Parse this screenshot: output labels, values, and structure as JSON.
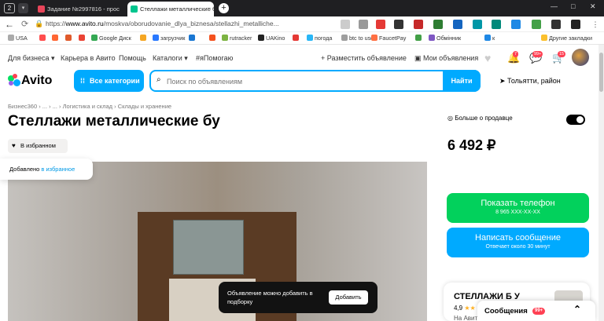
{
  "browser": {
    "tab_count": "2",
    "tabs": [
      {
        "title": "Задание №2997816 - прос",
        "favicon_color": "#e8455a"
      },
      {
        "title": "Стеллажи металлические б",
        "favicon_color": "#00c58e"
      }
    ],
    "url_host": "www.avito.ru",
    "url_prefix": "https://",
    "url_path": "/moskva/oborudovanie_dlya_biznesa/stellazhi_metalliche...",
    "tab_close": "×",
    "new_tab": "+",
    "window_buttons": [
      "—",
      "□",
      "✕"
    ]
  },
  "bookmarks": [
    {
      "label": "USA",
      "color": "#aaaaaa"
    },
    {
      "label": "",
      "color": "#ff4d4d"
    },
    {
      "label": "",
      "color": "#ff6633"
    },
    {
      "label": "",
      "color": "#e05a2b"
    },
    {
      "label": "",
      "color": "#ea4335"
    },
    {
      "label": "Google Диск",
      "color": "#34a853"
    },
    {
      "label": "",
      "color": "#f5a623"
    },
    {
      "label": "загрузчик",
      "color": "#2979ff"
    },
    {
      "label": "",
      "color": "#1976d2"
    },
    {
      "label": "",
      "color": "#f4511e"
    },
    {
      "label": "rutracker",
      "color": "#7cb342"
    },
    {
      "label": "UAKino",
      "color": "#222222"
    },
    {
      "label": "",
      "color": "#e53935"
    },
    {
      "label": "погода",
      "color": "#29b6f6"
    },
    {
      "label": "btc to usd",
      "color": "#9e9e9e"
    },
    {
      "label": "FaucetPay",
      "color": "#ff7043"
    },
    {
      "label": "",
      "color": "#43a047"
    },
    {
      "label": "Обмінник",
      "color": "#7e57c2"
    },
    {
      "label": "к",
      "color": "#1e88e5"
    },
    {
      "label": "Другие закладки",
      "color": "#fbc02d"
    }
  ],
  "nav": {
    "for_business": "Для бизнеса",
    "career": "Карьера в Авито",
    "help": "Помощь",
    "catalogs": "Каталоги",
    "hashtag": "#яПомогаю",
    "post_ad": "Разместить объявление",
    "my_ads": "Мои объявления",
    "notif_count": "7",
    "msg_count": "99+",
    "cart_count": "15"
  },
  "header": {
    "logo": "Avito",
    "categories": "Все категории",
    "search_placeholder": "Поиск по объявлениям",
    "search_button": "Найти",
    "location": "Тольятти, район"
  },
  "breadcrumbs": "Бизнес360 › ... › ... › Логистика и склад › Склады и хранение",
  "listing": {
    "title": "Стеллажи металлические бу",
    "favorite_label": "В избранном",
    "added_text": "Добавлено ",
    "added_link": "в избранное",
    "toast_text": "Объявление можно добавить в подборку",
    "toast_button": "Добавить",
    "price": "6 492 ₽"
  },
  "seller": {
    "more_about": "Больше о продавце",
    "show_phone": "Показать телефон",
    "phone_masked": "8 965 XXX-XX-XX",
    "write_message": "Написать сообщение",
    "response_time": "Отвечает около 30 минут",
    "name": "СТЕЛЛАЖИ Б У",
    "rating": "4,9",
    "stars": "★★",
    "since": "На Авито"
  },
  "messages": {
    "label": "Сообщения",
    "count": "99+"
  },
  "colors": {
    "avito_blue": "#00aaff",
    "avito_green": "#02d15c",
    "badge_red": "#ff4053"
  }
}
